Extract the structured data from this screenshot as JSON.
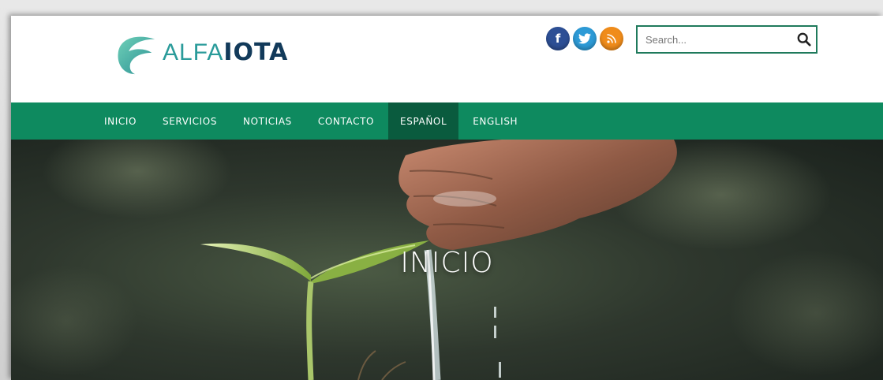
{
  "logo": {
    "light": "ALFA",
    "bold": "IOTA"
  },
  "social": [
    {
      "name": "facebook-icon",
      "glyph": "f",
      "color": "#2d4f95"
    },
    {
      "name": "twitter-icon",
      "glyph": "🐦",
      "color": "#2d9ad6"
    },
    {
      "name": "rss-icon",
      "glyph": "⌁",
      "color": "#f08c1a"
    }
  ],
  "search": {
    "placeholder": "Search..."
  },
  "nav": {
    "items": [
      "INICIO",
      "SERVICIOS",
      "NOTICIAS",
      "CONTACTO",
      "ESPAÑOL",
      "ENGLISH"
    ],
    "active_index": 4
  },
  "hero": {
    "title": "INICIO"
  },
  "colors": {
    "nav": "#0e8a5f",
    "nav_active": "#0a5b3e",
    "search_border": "#1f7a5c"
  }
}
